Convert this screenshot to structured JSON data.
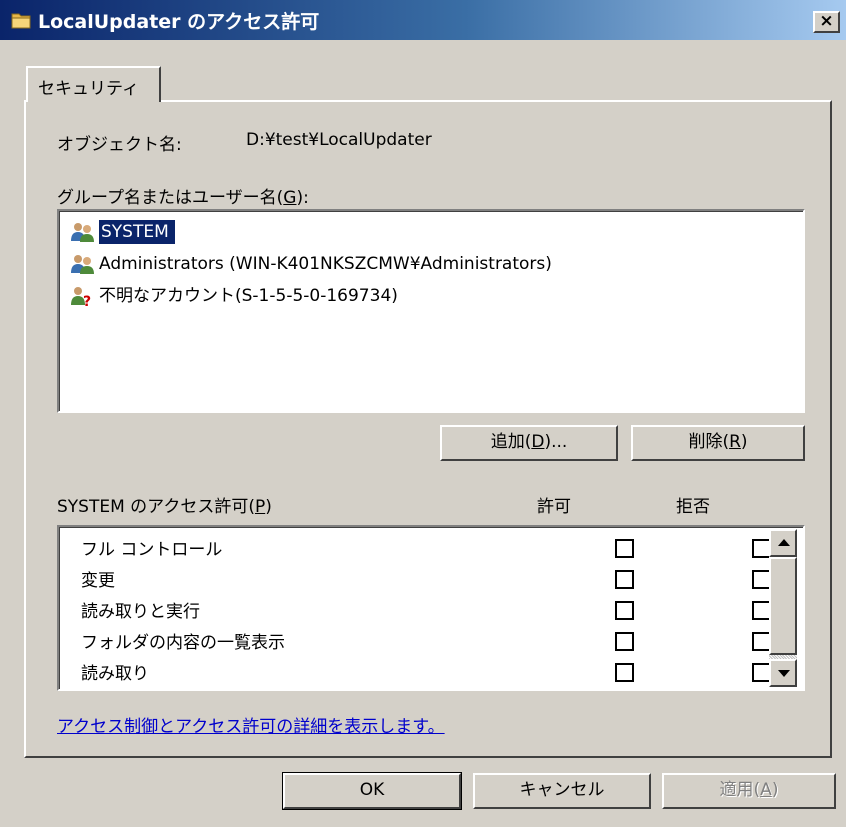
{
  "window": {
    "title": "LocalUpdater のアクセス許可",
    "close_label": "×"
  },
  "tabs": [
    {
      "label": "セキュリティ"
    }
  ],
  "object": {
    "label": "オブジェクト名:",
    "value": "D:¥test¥LocalUpdater"
  },
  "groups": {
    "label_text": "グループ名またはユーザー名(",
    "label_key": "G",
    "label_suffix": "):",
    "items": [
      {
        "name": "SYSTEM",
        "icon": "users-group-icon",
        "selected": true
      },
      {
        "name": "Administrators (WIN-K401NKSZCMW¥Administrators)",
        "icon": "users-group-icon",
        "selected": false
      },
      {
        "name": "不明なアカウント(S-1-5-5-0-169734)",
        "icon": "unknown-user-icon",
        "selected": false
      }
    ]
  },
  "buttons": {
    "add": {
      "text": "追加(",
      "key": "D",
      "suffix": ")..."
    },
    "remove": {
      "text": "削除(",
      "key": "R",
      "suffix": ")"
    },
    "ok": "OK",
    "cancel": "キャンセル",
    "apply": {
      "text": "適用(",
      "key": "A",
      "suffix": ")"
    }
  },
  "permissions": {
    "header_text": "SYSTEM のアクセス許可(",
    "header_key": "P",
    "header_suffix": ")",
    "allow_label": "許可",
    "deny_label": "拒否",
    "rows": [
      {
        "name": "フル コントロール",
        "allow": false,
        "deny": false
      },
      {
        "name": "変更",
        "allow": false,
        "deny": false
      },
      {
        "name": "読み取りと実行",
        "allow": false,
        "deny": false
      },
      {
        "name": "フォルダの内容の一覧表示",
        "allow": false,
        "deny": false
      },
      {
        "name": "読み取り",
        "allow": false,
        "deny": false
      }
    ]
  },
  "link": "アクセス制御とアクセス許可の詳細を表示します。",
  "colors": {
    "selection": "#0a246a",
    "face": "#d4d0c8",
    "link": "#0000cc"
  }
}
